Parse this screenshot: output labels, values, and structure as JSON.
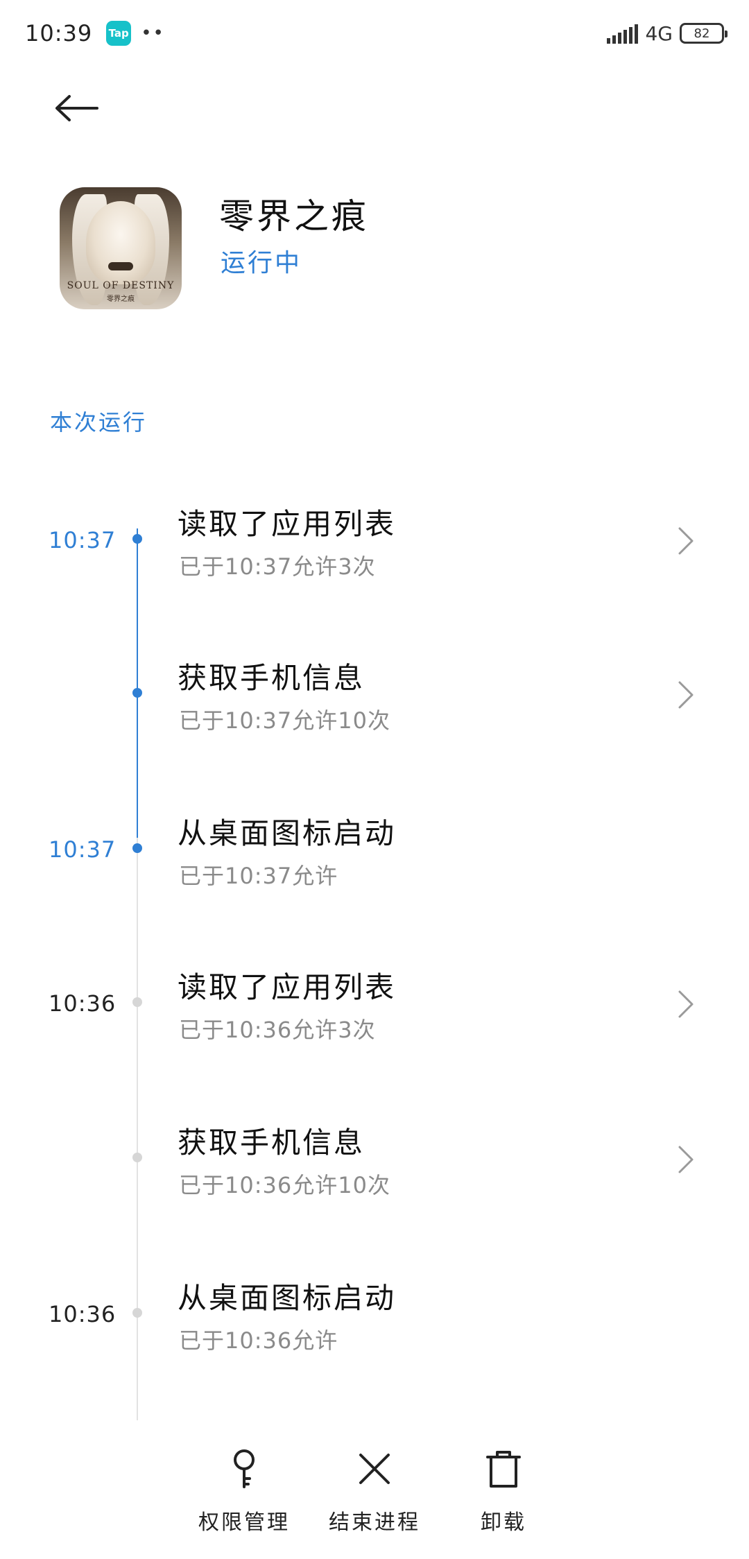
{
  "status_bar": {
    "time": "10:39",
    "app_badge": "Tap",
    "dots": "••",
    "network": "4G",
    "battery": "82"
  },
  "app": {
    "name": "零界之痕",
    "status": "运行中",
    "icon_text": "SOUL OF DESTINY",
    "icon_subtext": "零界之痕"
  },
  "section_title": "本次运行",
  "events": [
    {
      "time": "10:37",
      "title": "读取了应用列表",
      "subtitle": "已于10:37允许3次"
    },
    {
      "time": "",
      "title": "获取手机信息",
      "subtitle": "已于10:37允许10次"
    },
    {
      "time": "10:37",
      "title": "从桌面图标启动",
      "subtitle": "已于10:37允许"
    },
    {
      "time": "10:36",
      "title": "读取了应用列表",
      "subtitle": "已于10:36允许3次"
    },
    {
      "time": "",
      "title": "获取手机信息",
      "subtitle": "已于10:36允许10次"
    },
    {
      "time": "10:36",
      "title": "从桌面图标启动",
      "subtitle": "已于10:36允许"
    }
  ],
  "actions": {
    "permissions": "权限管理",
    "end_process": "结束进程",
    "uninstall": "卸载"
  },
  "colors": {
    "accent": "#2f7fd4",
    "inactive_dot": "#d6d6d6",
    "subtitle": "#8a8a8a"
  }
}
